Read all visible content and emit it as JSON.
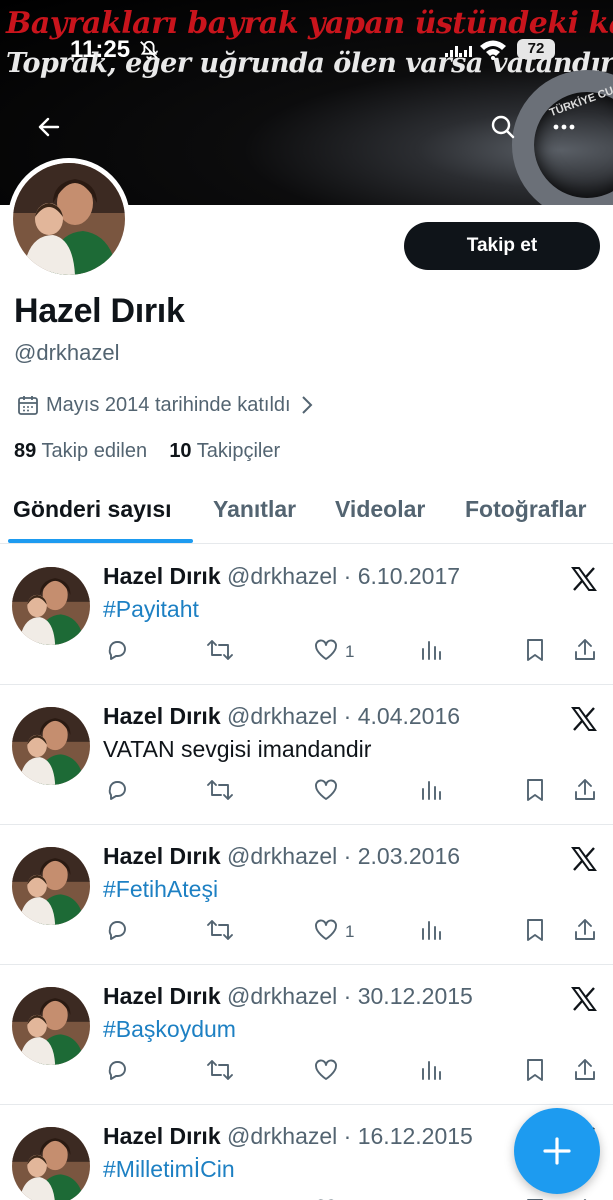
{
  "banner": {
    "line1": "Bayrakları bayrak yapan üstündeki kandır.",
    "line2": "Toprak, eğer uğrunda ölen varsa vatandır.",
    "emblem_text": "TÜRKİYE CU"
  },
  "status_bar": {
    "time": "11:25",
    "battery": "72"
  },
  "profile": {
    "name": "Hazel Dırık",
    "handle": "@drkhazel",
    "joined": "Mayıs 2014 tarihinde katıldı",
    "following_count": "89",
    "following_label": "Takip edilen",
    "followers_count": "10",
    "followers_label": "Takipçiler",
    "follow_button": "Takip et"
  },
  "tabs": [
    {
      "label": "Gönderi sayısı",
      "active": true
    },
    {
      "label": "Yanıtlar"
    },
    {
      "label": "Videolar"
    },
    {
      "label": "Fotoğraflar"
    }
  ],
  "tweets": [
    {
      "name": "Hazel Dırık",
      "meta": "@drkhazel · 6.10.2017",
      "text": "#Payitaht",
      "likes": "1"
    },
    {
      "name": "Hazel Dırık",
      "meta": "@drkhazel · 4.04.2016",
      "text": "VATAN sevgisi imandandir",
      "likes": ""
    },
    {
      "name": "Hazel Dırık",
      "meta": "@drkhazel · 2.03.2016",
      "text": "#FetihAteşi",
      "likes": "1"
    },
    {
      "name": "Hazel Dırık",
      "meta": "@drkhazel · 30.12.2015",
      "text": "#Başkoydum",
      "likes": ""
    },
    {
      "name": "Hazel Dırık",
      "meta": "@drkhazel · 16.12.2015",
      "text": "#MilletimİCin",
      "likes": ""
    }
  ],
  "colors": {
    "accent": "#1d9bf0",
    "hashtag": "#1d80c3",
    "muted": "#536471",
    "dark": "#0f1419"
  },
  "icons": [
    "back-arrow-icon",
    "search-icon",
    "more-icon",
    "calendar-icon",
    "chevron-right-icon",
    "reply-icon",
    "retweet-icon",
    "heart-icon",
    "views-icon",
    "bookmark-icon",
    "share-icon",
    "x-logo-icon",
    "plus-icon"
  ]
}
